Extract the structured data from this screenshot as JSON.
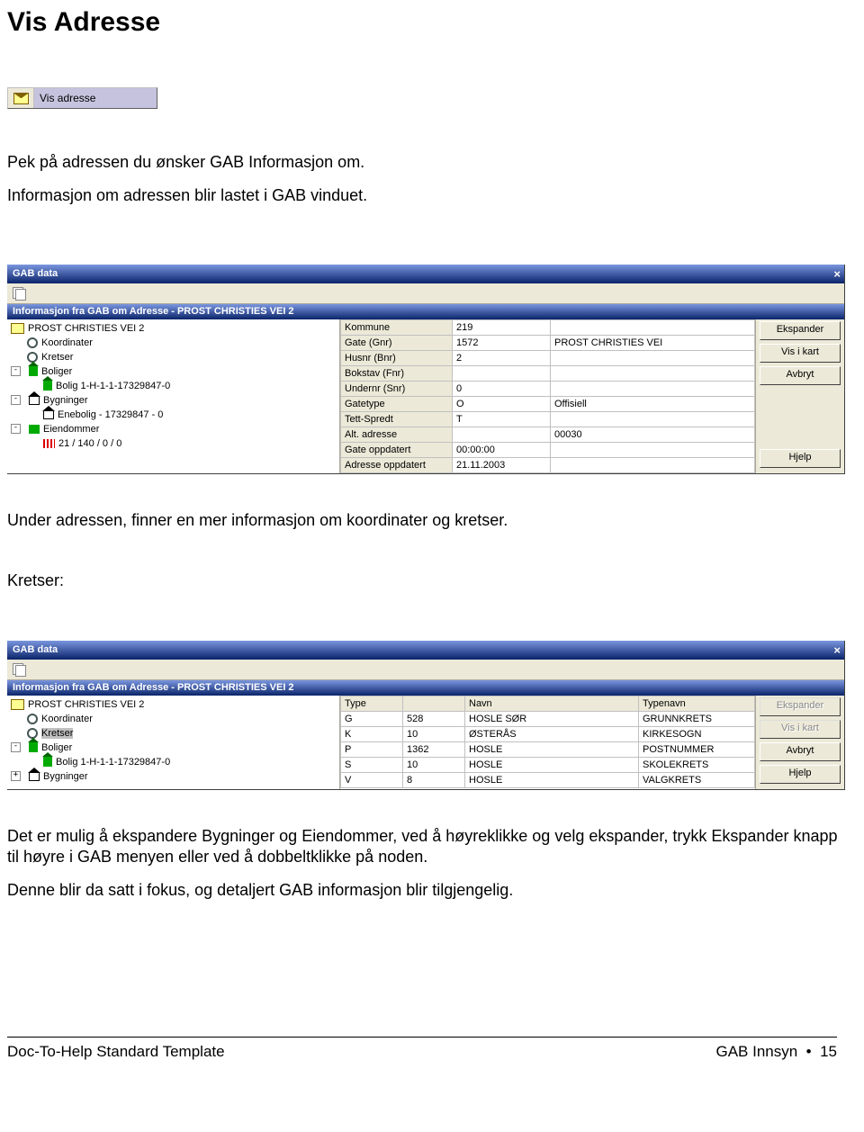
{
  "heading": "Vis Adresse",
  "toolbar": {
    "vis_adresse_label": "Vis adresse"
  },
  "intro": {
    "line1": "Pek på adressen du ønsker GAB Informasjon om.",
    "line2": "Informasjon om adressen blir lastet i GAB vinduet."
  },
  "window1": {
    "title": "GAB data",
    "subtitle": "Informasjon fra GAB om Adresse - PROST CHRISTIES VEI 2",
    "tree": {
      "root": "PROST CHRISTIES VEI 2",
      "koordinater": "Koordinater",
      "kretser": "Kretser",
      "boliger": "Boliger",
      "bolig_item": "Bolig 1-H-1-1-17329847-0",
      "bygninger": "Bygninger",
      "enebolig_item": "Enebolig - 17329847 - 0",
      "eiendommer": "Eiendommer",
      "eiendom_item": "21 / 140 / 0 / 0"
    },
    "grid": [
      {
        "label": "Kommune",
        "v1": "219",
        "v2": ""
      },
      {
        "label": "Gate (Gnr)",
        "v1": "1572",
        "v2": "PROST CHRISTIES VEI"
      },
      {
        "label": "Husnr (Bnr)",
        "v1": "2",
        "v2": ""
      },
      {
        "label": "Bokstav (Fnr)",
        "v1": "",
        "v2": ""
      },
      {
        "label": "Undernr (Snr)",
        "v1": "0",
        "v2": ""
      },
      {
        "label": "Gatetype",
        "v1": "O",
        "v2": "Offisiell"
      },
      {
        "label": "Tett-Spredt",
        "v1": "T",
        "v2": ""
      },
      {
        "label": "Alt. adresse",
        "v1": "",
        "v2": "00030"
      },
      {
        "label": "Gate oppdatert",
        "v1": "00:00:00",
        "v2": ""
      },
      {
        "label": "Adresse oppdatert",
        "v1": "21.11.2003",
        "v2": ""
      }
    ],
    "buttons": {
      "ekspander": "Ekspander",
      "vis_i_kart": "Vis i kart",
      "avbryt": "Avbryt",
      "hjelp": "Hjelp"
    }
  },
  "mid_text": "Under adressen, finner en mer informasjon om koordinater og kretser.",
  "kretser_label": "Kretser:",
  "window2": {
    "title": "GAB data",
    "subtitle": "Informasjon fra GAB om Adresse - PROST CHRISTIES VEI 2",
    "tree": {
      "root": "PROST CHRISTIES VEI 2",
      "koordinater": "Koordinater",
      "kretser": "Kretser",
      "boliger": "Boliger",
      "bolig_item": "Bolig 1-H-1-1-17329847-0",
      "bygninger": "Bygninger"
    },
    "headers": {
      "type": "Type",
      "blank": "",
      "navn": "Navn",
      "typenavn": "Typenavn"
    },
    "rows": [
      {
        "type": "G",
        "c2": "528",
        "navn": "HOSLE SØR",
        "typenavn": "GRUNNKRETS"
      },
      {
        "type": "K",
        "c2": "10",
        "navn": "ØSTERÅS",
        "typenavn": "KIRKESOGN"
      },
      {
        "type": "P",
        "c2": "1362",
        "navn": "HOSLE",
        "typenavn": "POSTNUMMER"
      },
      {
        "type": "S",
        "c2": "10",
        "navn": "HOSLE",
        "typenavn": "SKOLEKRETS"
      },
      {
        "type": "V",
        "c2": "8",
        "navn": "HOSLE",
        "typenavn": "VALGKRETS"
      }
    ],
    "buttons": {
      "ekspander": "Ekspander",
      "vis_i_kart": "Vis i kart",
      "avbryt": "Avbryt",
      "hjelp": "Hjelp"
    }
  },
  "end_text": {
    "p1": "Det er mulig å ekspandere Bygninger og Eiendommer, ved å høyreklikke og velg ekspander, trykk Ekspander knapp til høyre i GAB menyen eller ved å dobbeltklikke på noden.",
    "p2": "Denne blir da satt i fokus, og detaljert GAB informasjon blir tilgjengelig."
  },
  "footer": {
    "left": "Doc-To-Help Standard Template",
    "right_prefix": "GAB Innsyn",
    "bullet": "•",
    "page": "15"
  }
}
